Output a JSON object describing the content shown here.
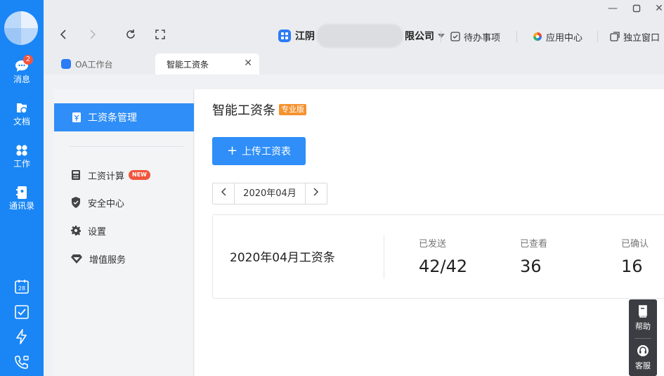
{
  "rail": {
    "items": [
      {
        "label": "消息",
        "badge": "2"
      },
      {
        "label": "文档"
      },
      {
        "label": "工作"
      },
      {
        "label": "通讯录"
      }
    ],
    "tools": [
      "calendar-icon",
      "todo-check-icon",
      "lightning-icon",
      "phone-icon"
    ],
    "calendar_day": "28"
  },
  "titlebar": {
    "company_prefix": "江阴",
    "company_suffix": "限公司",
    "actions": [
      {
        "label": "待办事项",
        "icon": "todo-icon"
      },
      {
        "label": "应用中心",
        "icon": "app-center-icon"
      },
      {
        "label": "独立窗口",
        "icon": "window-icon"
      }
    ]
  },
  "tabs": [
    {
      "label": "OA工作台",
      "active": false
    },
    {
      "label": "智能工资条",
      "active": true
    }
  ],
  "sidebar": {
    "active": "工资条管理",
    "items": [
      {
        "label": "工资计算",
        "badge": "NEW"
      },
      {
        "label": "安全中心"
      },
      {
        "label": "设置"
      },
      {
        "label": "增值服务"
      }
    ]
  },
  "main": {
    "title": "智能工资条",
    "edition_tag": "专业版",
    "upload_label": "上传工资表",
    "month": "2020年04月",
    "card": {
      "title": "2020年04月工资条",
      "stats": [
        {
          "label": "已发送",
          "value": "42/42"
        },
        {
          "label": "已查看",
          "value": "36"
        },
        {
          "label": "已确认",
          "value": "16"
        }
      ]
    }
  },
  "float": {
    "help": "帮助",
    "service": "客服"
  },
  "colors": {
    "rail": "#1a86f5",
    "accent": "#2f8ef7",
    "pro_tag": "#f5922f",
    "new_badge": "#f0553d"
  }
}
